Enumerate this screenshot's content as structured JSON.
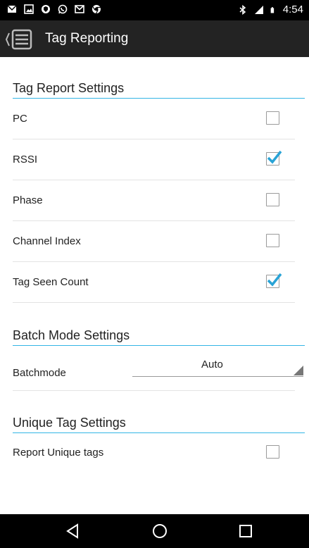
{
  "status_bar": {
    "time": "4:54",
    "icons": [
      "mail-icon",
      "image-icon",
      "shield-icon",
      "whatsapp-icon",
      "gmail-icon",
      "chrome-icon",
      "bluetooth-icon",
      "signal-icon",
      "battery-icon"
    ]
  },
  "action_bar": {
    "title": "Tag Reporting"
  },
  "tag_report": {
    "header": "Tag Report Settings",
    "items": [
      {
        "label": "PC",
        "checked": false
      },
      {
        "label": "RSSI",
        "checked": true
      },
      {
        "label": "Phase",
        "checked": false
      },
      {
        "label": "Channel Index",
        "checked": false
      },
      {
        "label": "Tag Seen Count",
        "checked": true
      }
    ]
  },
  "batch": {
    "header": "Batch Mode Settings",
    "label": "Batchmode",
    "value": "Auto"
  },
  "unique": {
    "header": "Unique Tag Settings",
    "label": "Report Unique tags",
    "checked": false
  },
  "colors": {
    "accent": "#33b5e5",
    "check": "#29a3d6"
  }
}
